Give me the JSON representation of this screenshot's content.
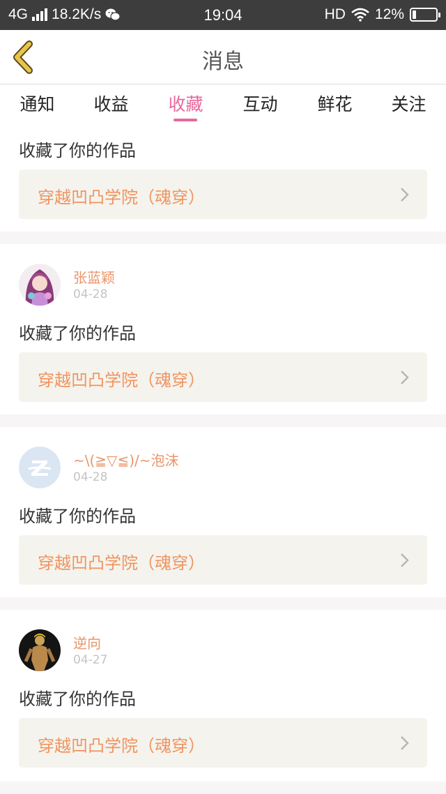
{
  "status_bar": {
    "network": "4G",
    "speed": "18.2K/s",
    "time": "19:04",
    "hd": "HD",
    "battery": "12%"
  },
  "header": {
    "title": "消息"
  },
  "tabs": [
    {
      "label": "通知",
      "active": false
    },
    {
      "label": "收益",
      "active": false
    },
    {
      "label": "收藏",
      "active": true
    },
    {
      "label": "互动",
      "active": false
    },
    {
      "label": "鲜花",
      "active": false
    },
    {
      "label": "关注",
      "active": false
    }
  ],
  "messages": [
    {
      "action": "收藏了你的作品",
      "work_title": "穿越凹凸学院（魂穿）"
    },
    {
      "user": "张蓝颖",
      "date": "04-28",
      "action": "收藏了你的作品",
      "work_title": "穿越凹凸学院（魂穿）"
    },
    {
      "user": "~\\(≧▽≦)/~泡沫",
      "date": "04-28",
      "action": "收藏了你的作品",
      "work_title": "穿越凹凸学院（魂穿）"
    },
    {
      "user": "逆向",
      "date": "04-27",
      "action": "收藏了你的作品",
      "work_title": "穿越凹凸学院（魂穿）"
    }
  ],
  "colors": {
    "accent": "#e8689c",
    "username": "#e9956a",
    "work_title": "#ef9460",
    "back_arrow": "#e8c44a"
  }
}
